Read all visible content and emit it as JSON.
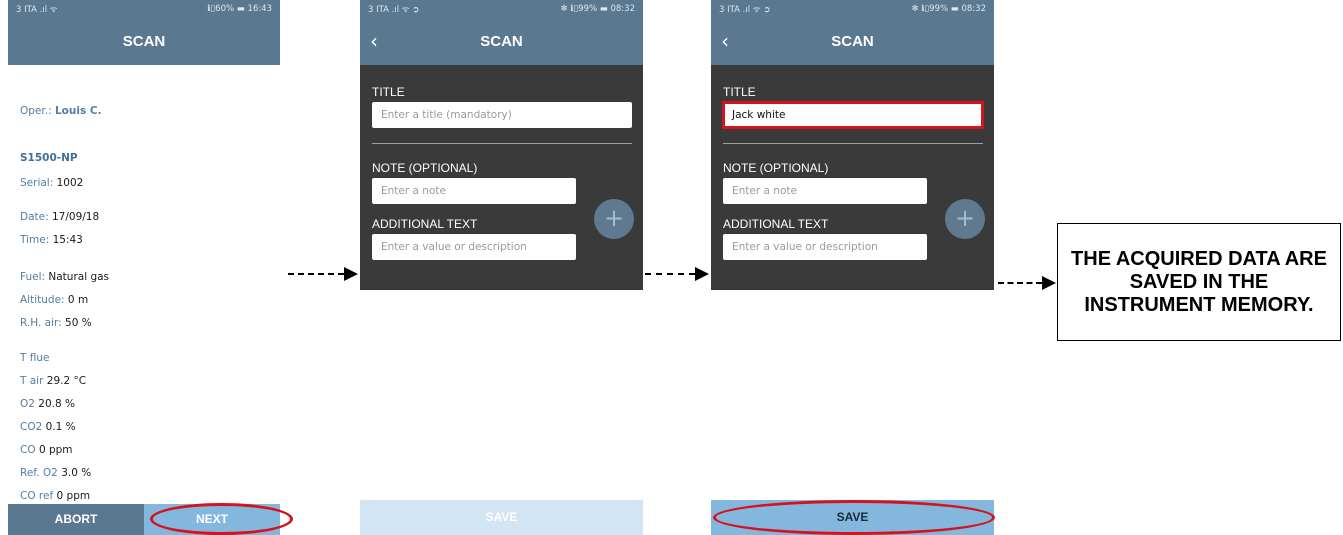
{
  "phone1": {
    "status_left": "3 ITA  .ıl ᯤ",
    "status_right": "ℹ▯60% ▬ 16:43",
    "title": "SCAN",
    "oper_label": "Oper.:",
    "oper_value": "Louis C.",
    "model": "S1500-NP",
    "serial_label": "Serial:",
    "serial_value": "1002",
    "date_label": "Date:",
    "date_value": "17/09/18",
    "time_label": "Time:",
    "time_value": "15:43",
    "fuel_label": "Fuel:",
    "fuel_value": "Natural gas",
    "altitude_label": "Altitude:",
    "altitude_value": "0 m",
    "rh_label": "R.H. air:",
    "rh_value": "50 %",
    "tflue_label": "T flue",
    "tair_label": "T air",
    "tair_value": "29.2 °C",
    "o2_label": "O2",
    "o2_value": "20.8 %",
    "co2_label": "CO2",
    "co2_value": "0.1 %",
    "co_label": "CO",
    "co_value": "0 ppm",
    "refo2_label": "Ref. O2",
    "refo2_value": "3.0 %",
    "coref_label": "CO ref",
    "coref_value": "0 ppm",
    "abort_label": "ABORT",
    "next_label": "NEXT"
  },
  "phone2": {
    "status_left": "3 ITA  .ıl ᯤ ➲",
    "status_right": "✻ ℹ▯99% ▬ 08:32",
    "back": "‹",
    "title": "SCAN",
    "title_label": "TITLE",
    "title_placeholder": "Enter a title (mandatory)",
    "note_label": "NOTE (OPTIONAL)",
    "note_placeholder": "Enter a note",
    "additional_label": "ADDITIONAL TEXT",
    "additional_placeholder": "Enter a value or description",
    "plus": "+",
    "save_label": "SAVE"
  },
  "phone3": {
    "status_left": "3 ITA  .ıl ᯤ ➲",
    "status_right": "✻ ℹ▯99% ▬ 08:32",
    "back": "‹",
    "title": "SCAN",
    "title_label": "TITLE",
    "title_value": "Jack white",
    "note_label": "NOTE (OPTIONAL)",
    "note_placeholder": "Enter a note",
    "additional_label": "ADDITIONAL TEXT",
    "additional_placeholder": "Enter a value or description",
    "plus": "+",
    "save_label": "SAVE"
  },
  "note": "THE ACQUIRED DATA ARE SAVED IN THE INSTRUMENT MEMORY.",
  "colors": {
    "appbar": "#5a7890",
    "dark_panel": "#3a3a3a",
    "button_active": "#84b7dd",
    "button_disabled": "#d2e5f5",
    "highlight": "#d6121c"
  }
}
